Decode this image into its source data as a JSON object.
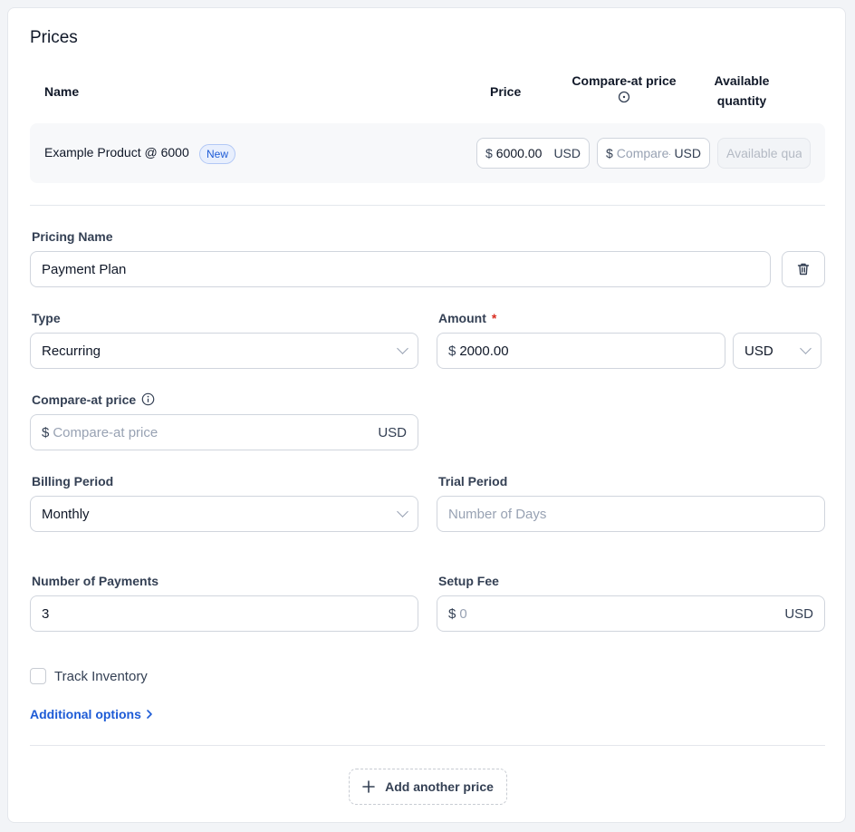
{
  "section": {
    "title": "Prices"
  },
  "columns": {
    "name": "Name",
    "price": "Price",
    "compare_at_price": "Compare-at price",
    "available_quantity_line1": "Available",
    "available_quantity_line2": "quantity"
  },
  "product_row": {
    "name": "Example Product @ 6000",
    "badge": "New",
    "price": {
      "prefix": "$",
      "value": "6000.00",
      "suffix": "USD"
    },
    "compare_at": {
      "prefix": "$",
      "placeholder": "Compare-at price",
      "suffix": "USD"
    },
    "available_quantity": {
      "placeholder": "Available quantity"
    }
  },
  "pricing_name": {
    "label": "Pricing Name",
    "value": "Payment Plan"
  },
  "type": {
    "label": "Type",
    "value": "Recurring"
  },
  "amount": {
    "label": "Amount",
    "required_mark": "*",
    "prefix": "$",
    "value": "2000.00",
    "currency": "USD"
  },
  "compare_at_price": {
    "label": "Compare-at price",
    "prefix": "$",
    "placeholder": "Compare-at price",
    "suffix": "USD"
  },
  "billing_period": {
    "label": "Billing Period",
    "value": "Monthly"
  },
  "trial_period": {
    "label": "Trial Period",
    "placeholder": "Number of Days"
  },
  "number_of_payments": {
    "label": "Number of Payments",
    "value": "3"
  },
  "setup_fee": {
    "label": "Setup Fee",
    "prefix": "$",
    "placeholder": "0",
    "suffix": "USD"
  },
  "track_inventory": {
    "label": "Track Inventory",
    "checked": false
  },
  "additional_options": {
    "label": "Additional options"
  },
  "add_price": {
    "label": "Add another price"
  },
  "colors": {
    "accent": "#1d5bd6",
    "badge_bg": "#e8effd",
    "required": "#d92d20"
  },
  "icons": [
    "info-icon",
    "trash-icon",
    "chevron-down-icon",
    "chevron-right-icon",
    "plus-icon"
  ]
}
